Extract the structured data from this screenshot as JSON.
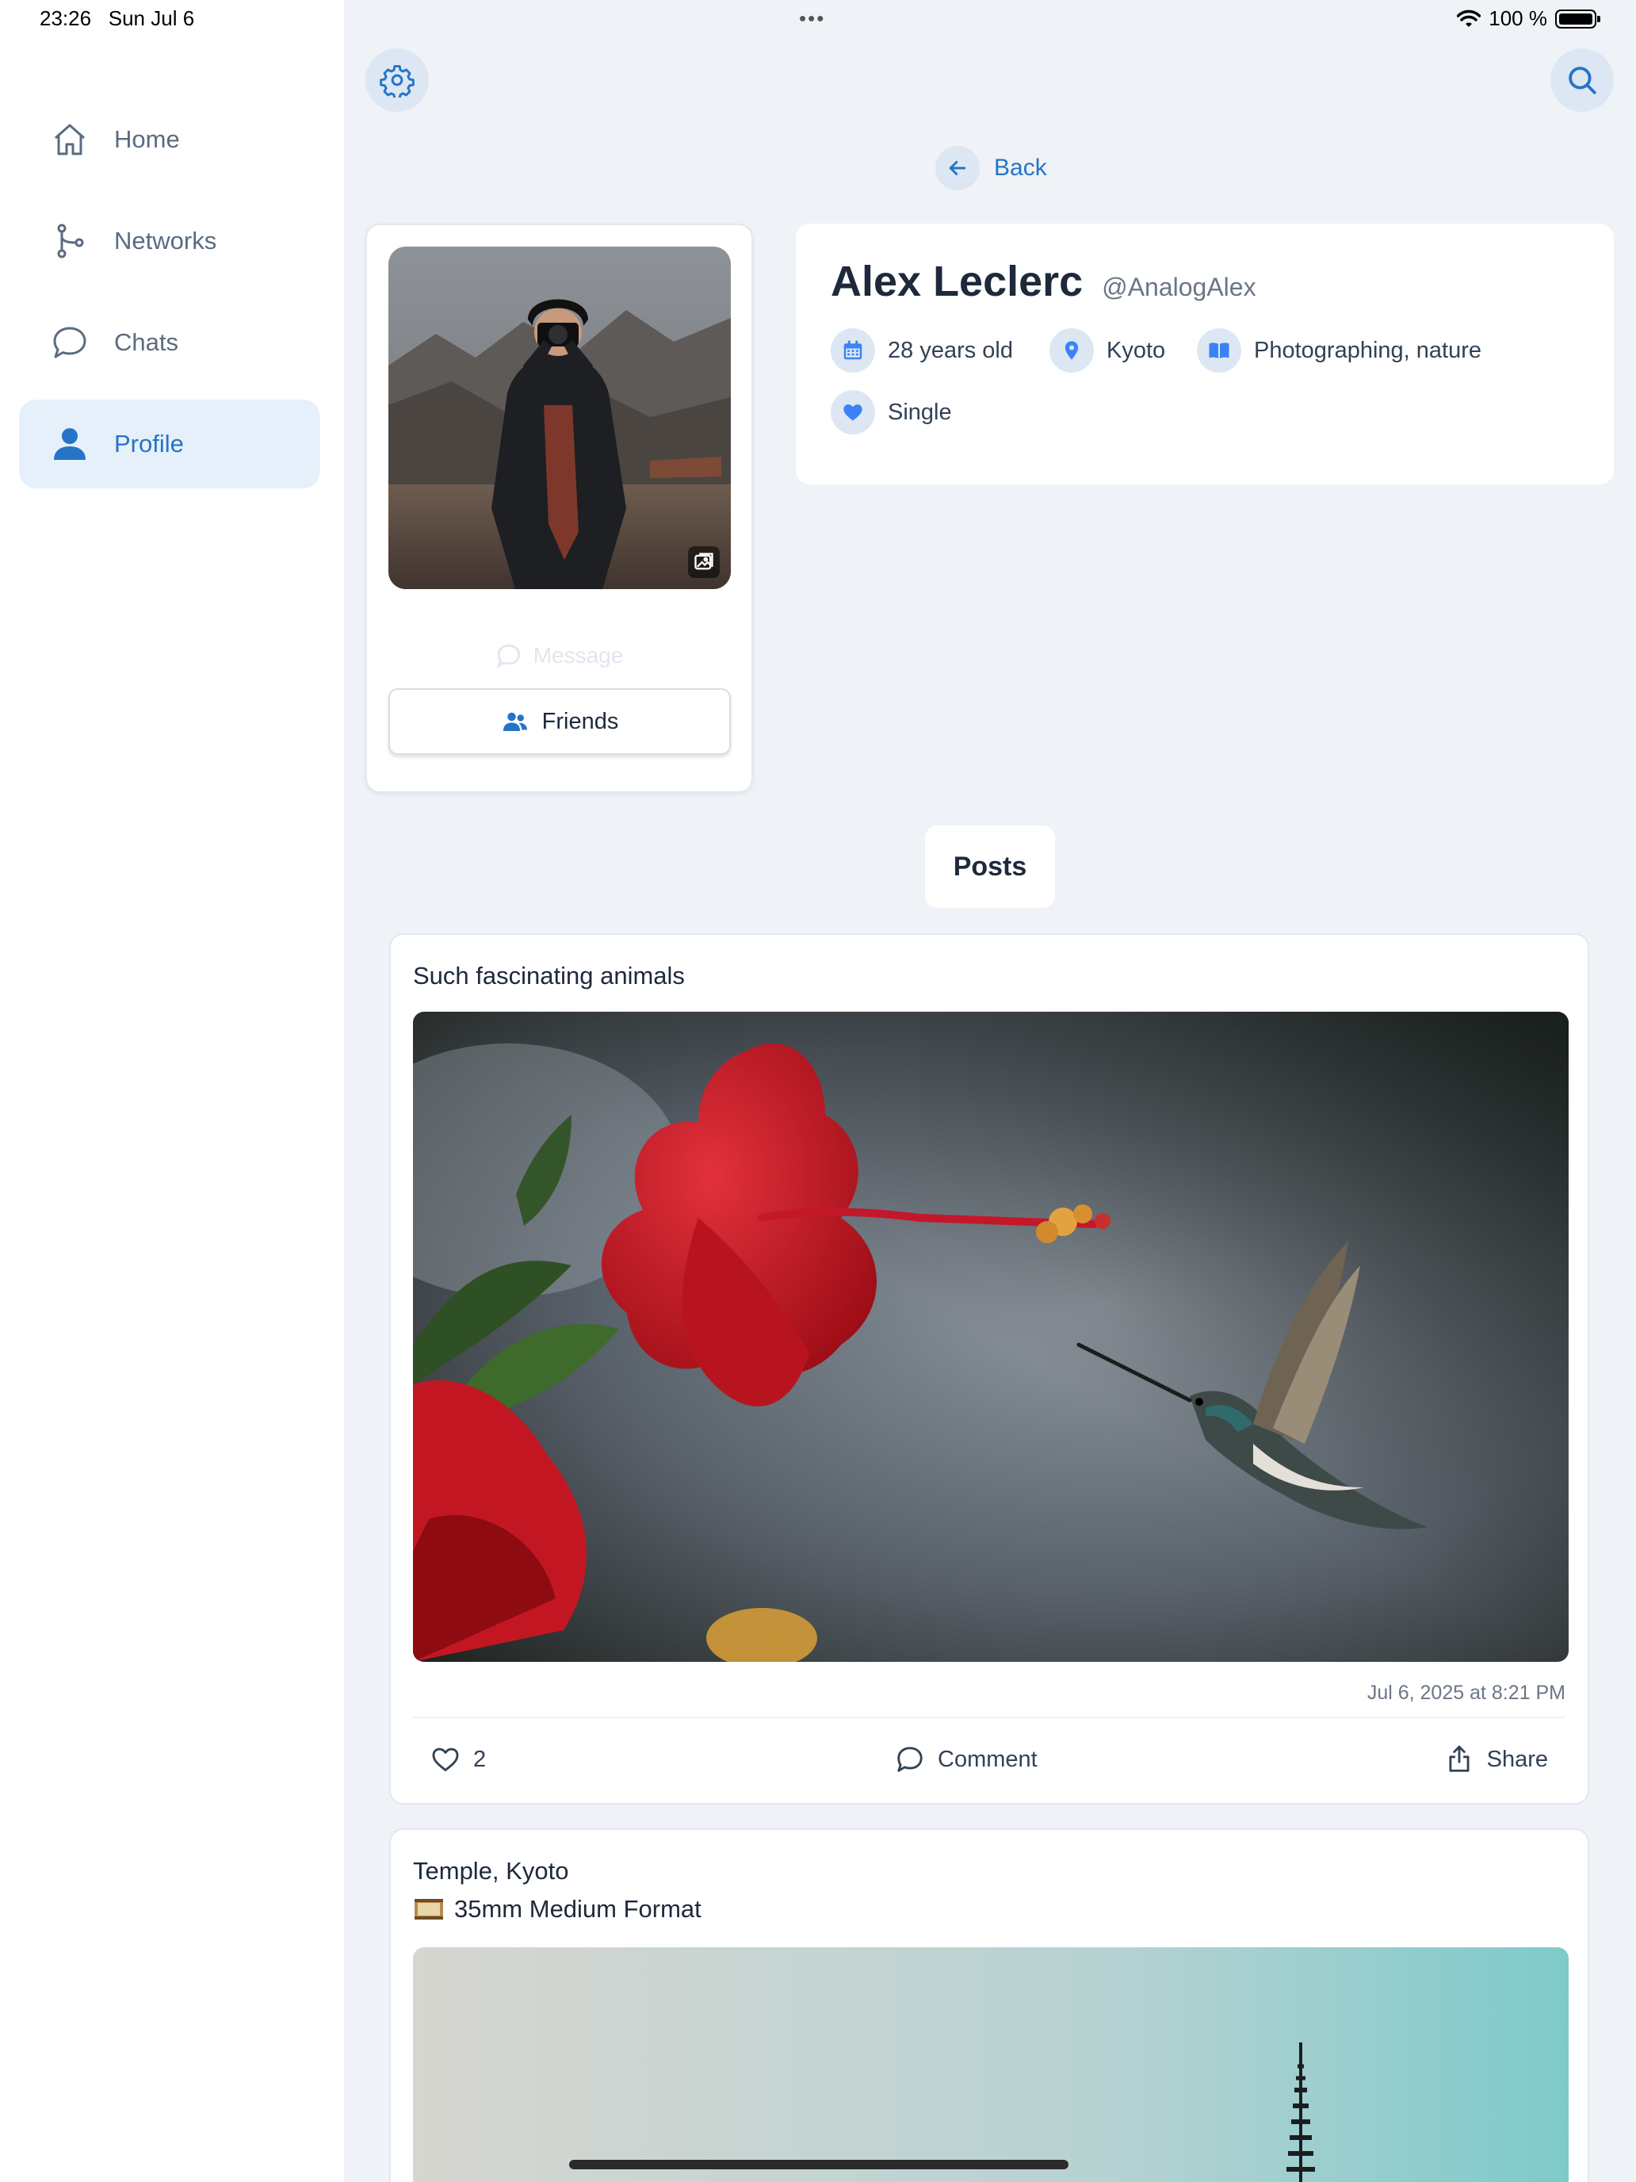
{
  "status_bar": {
    "time": "23:26",
    "date": "Sun Jul 6",
    "multitask_dots": "•••",
    "battery": "100 %",
    "battery_level": 1.0
  },
  "sidebar": {
    "items": [
      {
        "label": "Home",
        "icon": "home-icon",
        "active": false
      },
      {
        "label": "Networks",
        "icon": "network-icon",
        "active": false
      },
      {
        "label": "Chats",
        "icon": "chat-bubble-icon",
        "active": false
      },
      {
        "label": "Profile",
        "icon": "person-icon",
        "active": true
      }
    ]
  },
  "header": {
    "back_label": "Back"
  },
  "profile": {
    "name": "Alex Leclerc",
    "handle": "@AnalogAlex",
    "message_label": "Message",
    "friends_label": "Friends",
    "details": {
      "age": "28 years old",
      "location": "Kyoto",
      "interests": "Photographing, nature",
      "relationship": "Single"
    }
  },
  "tabs": {
    "posts_label": "Posts"
  },
  "posts": [
    {
      "title": "Such fascinating animals",
      "timestamp": "Jul 6, 2025 at 8:21 PM",
      "likes": "2",
      "comment_label": "Comment",
      "share_label": "Share"
    },
    {
      "title": "Temple, Kyoto",
      "subtitle": "35mm Medium Format",
      "subtitle_icon": "film-icon"
    }
  ],
  "colors": {
    "accent": "#2674c8",
    "icon_blue": "#3b82f6",
    "chip_bg": "#dde7f3",
    "background": "#eff2f7"
  }
}
